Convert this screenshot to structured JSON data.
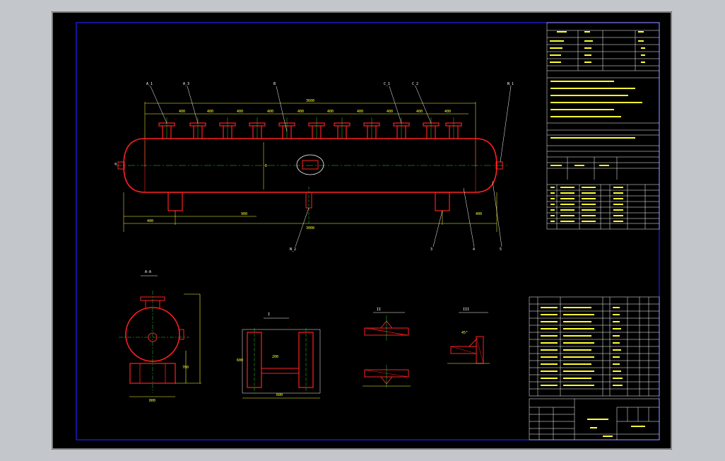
{
  "drawing": {
    "section_label": "A-A",
    "detail_labels": [
      "I",
      "II",
      "III"
    ],
    "colors": {
      "background": "#000000",
      "frame": "#2222ff",
      "vessel": "#ff2020",
      "dimension": "#ffff33",
      "centerline": "#33cc33",
      "text": "#ffffff",
      "leader": "#ffffff"
    }
  },
  "vessel": {
    "nozzle_count": 11,
    "support_count": 2,
    "manhole_count": 1
  }
}
